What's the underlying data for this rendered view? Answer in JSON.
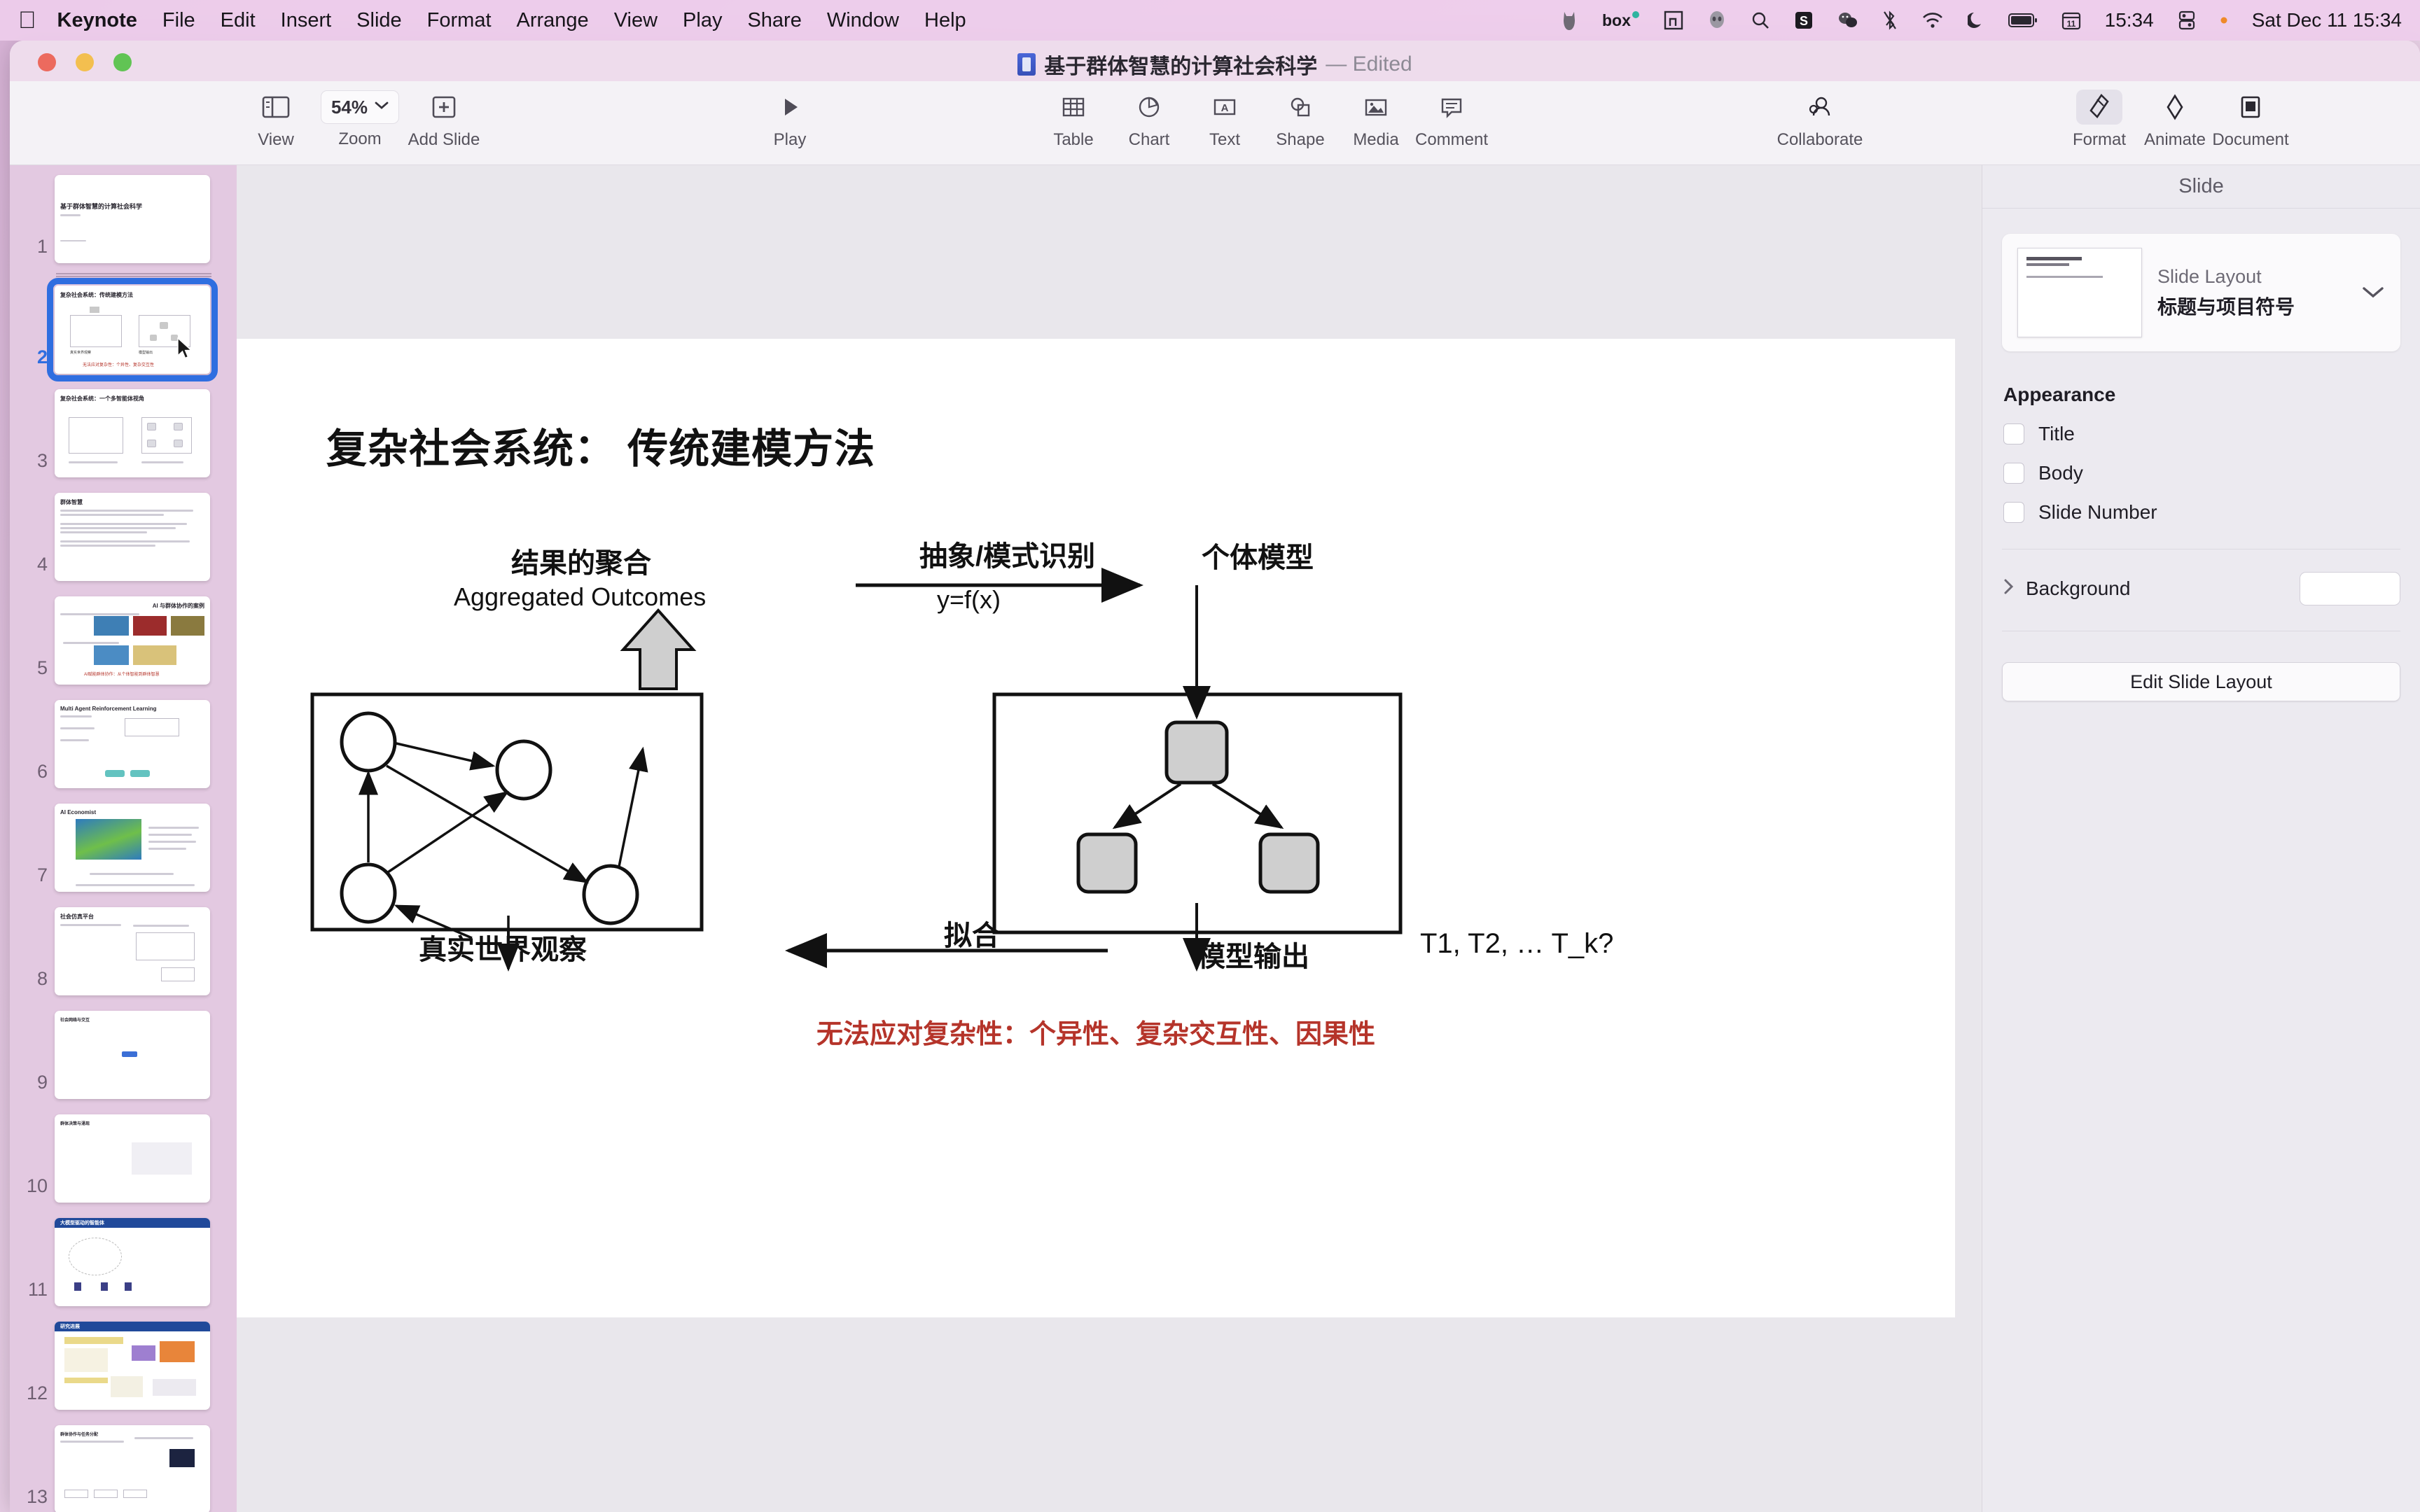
{
  "menubar": {
    "apple": "apple-logo",
    "items": [
      "Keynote",
      "File",
      "Edit",
      "Insert",
      "Slide",
      "Format",
      "Arrange",
      "View",
      "Play",
      "Share",
      "Window",
      "Help"
    ],
    "status_icons": [
      "cat-icon",
      "box-logo",
      "screenshot-icon",
      "alien-icon",
      "search-icon",
      "sogou-icon",
      "wechat-icon",
      "bluetooth-off-icon",
      "wifi-icon",
      "do-not-disturb-icon",
      "battery-icon",
      "calendar-icon"
    ],
    "calendar_time": "15:34",
    "clock": "Sat Dec 11  15:34"
  },
  "window": {
    "title": "基于群体智慧的计算社会科学",
    "edited_badge": "— Edited"
  },
  "toolbar": {
    "view_label": "View",
    "zoom_value": "54%",
    "zoom_label": "Zoom",
    "add_slide_label": "Add Slide",
    "play_label": "Play",
    "table_label": "Table",
    "chart_label": "Chart",
    "text_label": "Text",
    "shape_label": "Shape",
    "media_label": "Media",
    "comment_label": "Comment",
    "collaborate_label": "Collaborate",
    "format_label": "Format",
    "animate_label": "Animate",
    "document_label": "Document"
  },
  "navigator": {
    "selected_index": 2,
    "slides": [
      {
        "num": "1",
        "title": "基于群体智慧的计算社会科学",
        "kind": "title"
      },
      {
        "num": "2",
        "title": "复杂社会系统：传统建模方法",
        "kind": "diagram-current"
      },
      {
        "num": "3",
        "title": "复杂社会系统：一个多智能体视角",
        "kind": "diagram2"
      },
      {
        "num": "4",
        "title": "群体智慧",
        "kind": "text"
      },
      {
        "num": "5",
        "title": "AI 与群体协作的案例",
        "kind": "images"
      },
      {
        "num": "6",
        "title": "Multi Agent Reinforcement Learning",
        "kind": "marl"
      },
      {
        "num": "7",
        "title": "AI Economist",
        "kind": "economist"
      },
      {
        "num": "8",
        "title": "社会仿真平台",
        "kind": "twocol"
      },
      {
        "num": "9",
        "title": "社会网络与交互",
        "kind": "network"
      },
      {
        "num": "10",
        "title": "群体决策与涌现",
        "kind": "grid"
      },
      {
        "num": "11",
        "title": "大模型驱动的智能体",
        "kind": "banner"
      },
      {
        "num": "12",
        "title": "研究进展",
        "kind": "banner2"
      },
      {
        "num": "13",
        "title": "群体协作与任务分配",
        "kind": "agents"
      }
    ]
  },
  "slide": {
    "title": "复杂社会系统：  传统建模方法",
    "aggregated_cn": "结果的聚合",
    "aggregated_en": "Aggregated Outcomes",
    "abstraction_label": "抽象/模式识别",
    "function_label": "y=f(x)",
    "individual_model_label": "个体模型",
    "real_world_label": "真实世界观察",
    "fit_label": "拟合",
    "model_output_label": "模型输出",
    "tk_label": "T1, T2, … T_k?",
    "red_note": "无法应对复杂性：个异性、复杂交互性、因果性",
    "colors": {
      "red_note": "#b5342a",
      "node_fill": "#cfcfcf",
      "stroke": "#111111"
    }
  },
  "inspector": {
    "header": "Slide",
    "layout_sub": "Slide Layout",
    "layout_name": "标题与项目符号",
    "chevron": "chevron-down-icon",
    "appearance_title": "Appearance",
    "checkboxes": [
      {
        "label": "Title",
        "checked": false
      },
      {
        "label": "Body",
        "checked": false
      },
      {
        "label": "Slide Number",
        "checked": false
      }
    ],
    "background_label": "Background",
    "edit_slide_layout": "Edit Slide Layout"
  }
}
